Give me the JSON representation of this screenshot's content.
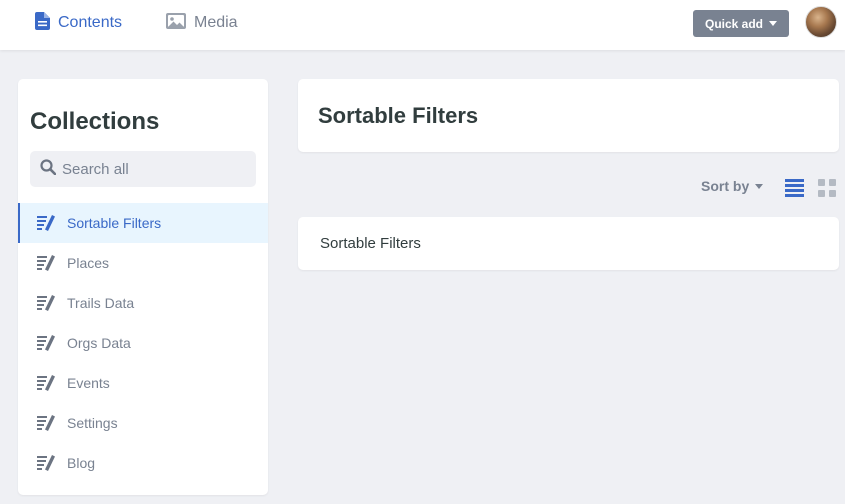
{
  "nav": {
    "contents_label": "Contents",
    "media_label": "Media",
    "quick_add_label": "Quick add"
  },
  "sidebar": {
    "title": "Collections",
    "search_placeholder": "Search all",
    "items": [
      {
        "label": "Sortable Filters",
        "active": true
      },
      {
        "label": "Places"
      },
      {
        "label": "Trails Data"
      },
      {
        "label": "Orgs Data"
      },
      {
        "label": "Events"
      },
      {
        "label": "Settings"
      },
      {
        "label": "Blog"
      }
    ]
  },
  "main": {
    "title": "Sortable Filters",
    "sort_by_label": "Sort by",
    "entries": [
      {
        "title": "Sortable Filters"
      }
    ]
  },
  "colors": {
    "accent": "#3a69c7",
    "muted": "#798291",
    "background": "#eff0f4",
    "active_bg": "#e8f5fe"
  }
}
